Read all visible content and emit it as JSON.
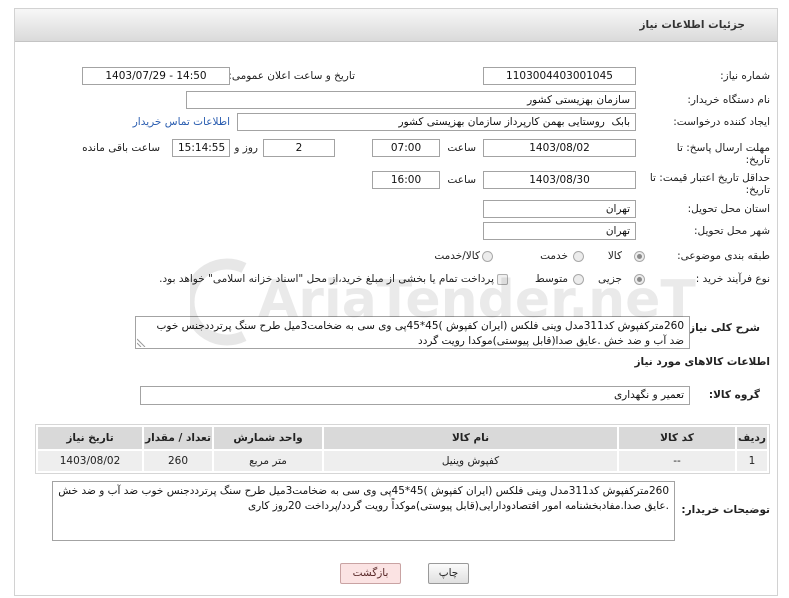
{
  "header": {
    "title": "جزئیات اطلاعات نیاز"
  },
  "need_number": {
    "label": "شماره نیاز:",
    "value": "1103004403001045"
  },
  "announce": {
    "label": "تاریخ و ساعت اعلان عمومی:",
    "value": "1403/07/29 - 14:50"
  },
  "buyer_org": {
    "label": "نام دستگاه خریدار:",
    "value": "سازمان بهزیستی کشور"
  },
  "requester": {
    "label": "ایجاد کننده درخواست:",
    "value": "بابک  روستایی بهمن کارپرداز سازمان بهزیستی کشور",
    "contact_link": "اطلاعات تماس خریدار"
  },
  "response_deadline": {
    "label_lines": [
      "مهلت ارسال پاسخ: تا",
      "تاریخ:"
    ],
    "date": "1403/08/02",
    "time_label": "ساعت",
    "time": "07:00",
    "days_remaining": "2",
    "days_label": "روز و",
    "hours_remaining": "15:14:55",
    "hours_label": "ساعت باقی مانده"
  },
  "price_validity": {
    "label_lines": [
      "حداقل تاریخ اعتبار قیمت: تا",
      "تاریخ:"
    ],
    "date": "1403/08/30",
    "time_label": "ساعت",
    "time": "16:00"
  },
  "delivery_province": {
    "label": "استان محل تحویل:",
    "value": "تهران"
  },
  "delivery_city": {
    "label": "شهر محل تحویل:",
    "value": "تهران"
  },
  "category": {
    "label": "طبقه بندی موضوعی:",
    "options": [
      {
        "label": "کالا",
        "selected": true
      },
      {
        "label": "خدمت",
        "selected": false
      },
      {
        "label": "کالا/خدمت",
        "selected": false
      }
    ]
  },
  "purchase_process": {
    "label": "نوع فرآیند خرید :",
    "options": [
      {
        "label": "جزیی",
        "selected": true
      },
      {
        "label": "متوسط",
        "selected": false
      }
    ],
    "treasury": {
      "label": "پرداخت تمام یا بخشی از مبلغ خرید،از محل \"اسناد خزانه اسلامی\" خواهد بود.",
      "checked": false
    }
  },
  "general_description": {
    "label": "شرح کلی نیاز:",
    "value": "260مترکفپوش کد311مدل وینی فلکس (ایران کفپوش )45*45پی وی سی به ضخامت3میل طرح سنگ پرترددجنس خوب ضد آب و ضد خش .عایق صدا(قابل پیوستی)موکدا رویت گردد"
  },
  "goods": {
    "section_title": "اطلاعات کالاهای مورد نیاز",
    "group": {
      "label": "گروه کالا:",
      "value": "تعمیر و نگهداری"
    },
    "columns": [
      "ردیف",
      "کد کالا",
      "نام کالا",
      "واحد شمارش",
      "تعداد / مقدار",
      "تاریخ نیاز"
    ],
    "rows": [
      [
        "1",
        "--",
        "کفپوش وینیل",
        "متر مربع",
        "260",
        "1403/08/02"
      ]
    ]
  },
  "buyer_notes": {
    "label": "توضیحات خریدار:",
    "value": "260مترکفپوش کد311مدل وینی فلکس (ایران کفپوش )45*45پی وی سی به ضخامت3میل طرح سنگ پرترددجنس خوب ضد آب و ضد خش .عایق صدا.مفادبخشنامه امور اقتصادودارایی(قابل پیوستی)موکداً رویت گردد/پرداخت 20روز کاری"
  },
  "actions": {
    "print": "چاپ",
    "back": "بازگشت"
  },
  "watermark": {
    "text": "AriaTender.neT"
  },
  "theme": {
    "link_color": "#2a5db0",
    "back_button_bg": "#fbe3e3",
    "header_bg": "#dadada"
  }
}
